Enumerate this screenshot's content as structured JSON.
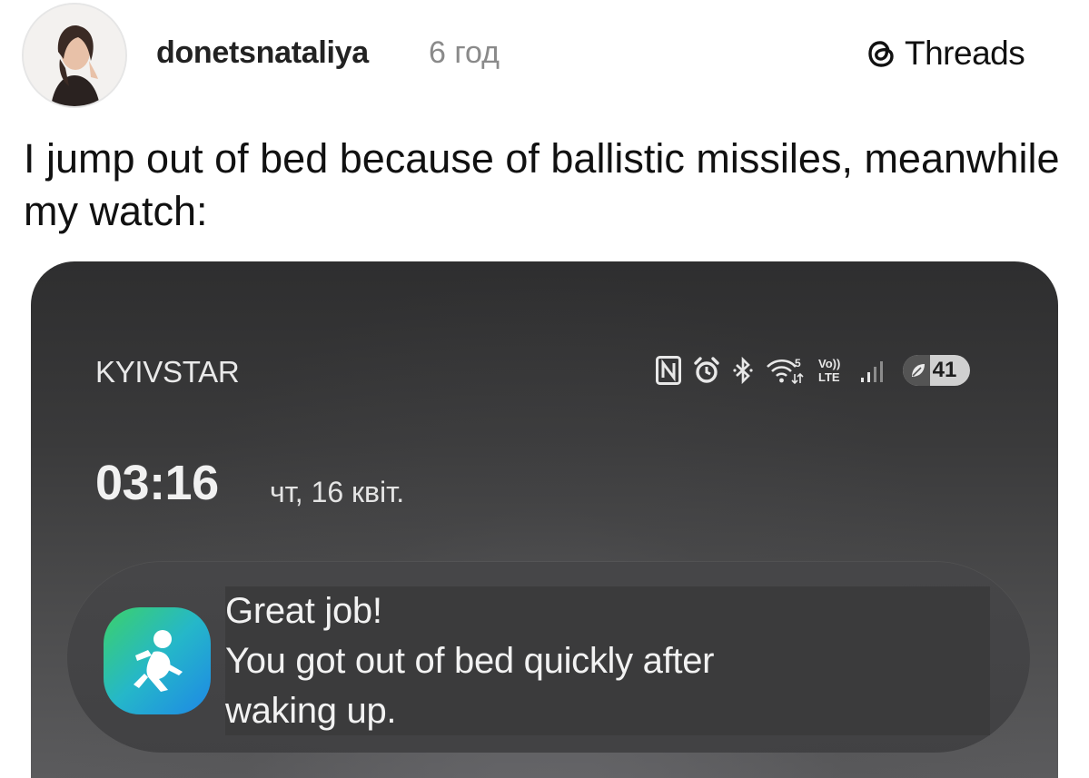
{
  "post": {
    "username": "donetsnataliya",
    "time_ago": "6 год",
    "brand": "Threads",
    "caption": "I jump out of bed because of ballistic missiles, meanwhile my watch:"
  },
  "phone": {
    "carrier": "KYIVSTAR",
    "status_icons": [
      "nfc-icon",
      "alarm-icon",
      "bluetooth-icon",
      "wifi-icon",
      "volte-icon",
      "signal-icon"
    ],
    "battery_level": "41",
    "time": "03:16",
    "date": "чт, 16 квіт."
  },
  "notification": {
    "app_icon": "fitness-app-icon",
    "title": "Great job!",
    "line1": "You got out of bed quickly after",
    "line2": "waking up."
  },
  "colors": {
    "accent_icon_start": "#3cd16a",
    "accent_icon_end": "#1e88e5",
    "phone_bg": "#3a3a3b"
  }
}
